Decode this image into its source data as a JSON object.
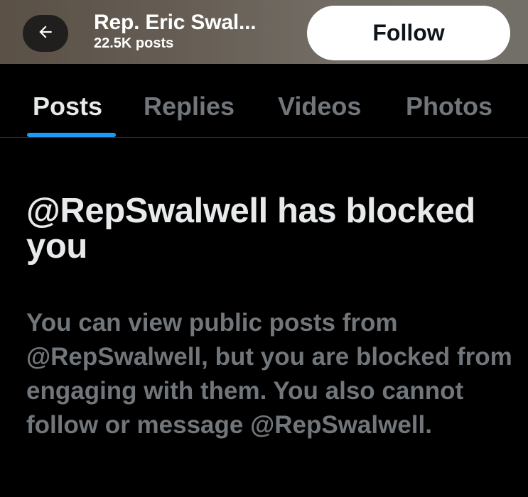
{
  "header": {
    "profile_name": "Rep. Eric Swal...",
    "post_count": "22.5K posts",
    "follow_label": "Follow",
    "back_icon": "arrow-left-icon"
  },
  "tabs": [
    {
      "label": "Posts",
      "active": true
    },
    {
      "label": "Replies",
      "active": false
    },
    {
      "label": "Videos",
      "active": false
    },
    {
      "label": "Photos",
      "active": false
    }
  ],
  "blocked": {
    "heading": "@RepSwalwell has blocked you",
    "body": "You can view public posts from @RepSwalwell, but you are blocked from engaging with them. You also cannot follow or message @RepSwalwell."
  },
  "colors": {
    "accent": "#1d9bf0",
    "background": "#000000",
    "text_primary": "#e7e9ea",
    "text_secondary": "#71767b"
  }
}
